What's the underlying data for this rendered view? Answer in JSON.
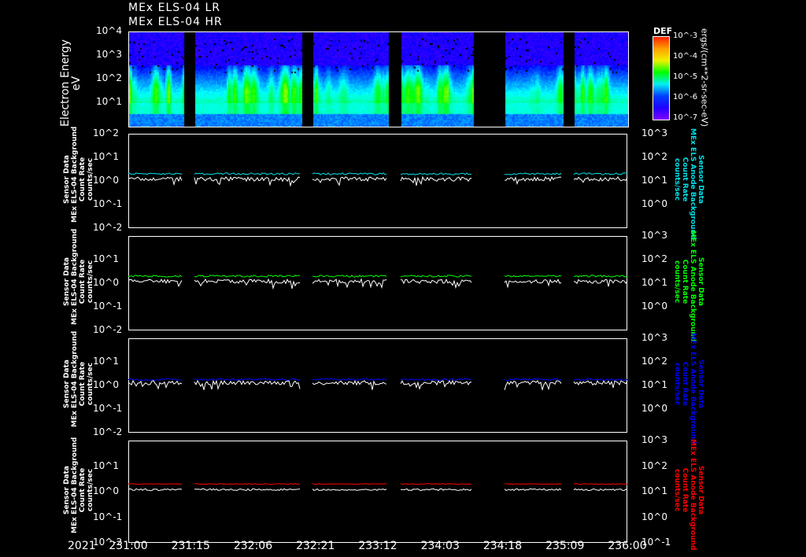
{
  "titles": [
    "MEx ELS-04 LR",
    "MEx ELS-04 HR"
  ],
  "colors": {
    "cyan": "#00e0e8",
    "green": "#00ff00",
    "blue": "#0000ff",
    "red": "#ff0000",
    "white": "#ffffff"
  },
  "chart_data": {
    "type": "heatmap+line",
    "year_label": "2021",
    "x_tick_labels": [
      "231:00",
      "231:15",
      "232:06",
      "232:21",
      "233:12",
      "234:03",
      "234:18",
      "235:09",
      "236:00"
    ],
    "data_gaps_fraction_of_time": [
      [
        0.11,
        0.132
      ],
      [
        0.345,
        0.368
      ],
      [
        0.52,
        0.543
      ],
      [
        0.688,
        0.752
      ],
      [
        0.87,
        0.892
      ]
    ],
    "spectrogram": {
      "ylabel": "Electron Energy",
      "yunits": "eV",
      "y_ticks": [
        "10^4",
        "10^3",
        "10^2",
        "10^1"
      ],
      "ylim": [
        1,
        10000
      ],
      "colorbar": {
        "title": "DEF",
        "units": "ergs/(cm**2-sr-sec-eV)",
        "ticks": [
          "10^-3",
          "10^-4",
          "10^-5",
          "10^-6",
          "10^-7"
        ],
        "range": [
          1e-07,
          0.001
        ]
      }
    },
    "panels": [
      {
        "left_label": [
          "Sensor Data",
          "MEx ELS-04 Background",
          "Count Rate",
          "counts/sec"
        ],
        "right_label": [
          "Sensor Data",
          "MEx ELS Anode Background",
          "Count Rate",
          "counts/sec"
        ],
        "color_key": "cyan",
        "colored_level": 2.0,
        "white_level": 1.2
      },
      {
        "left_label": [
          "Sensor Data",
          "MEx ELS-04 Background",
          "Count Rate",
          "counts/sec"
        ],
        "right_label": [
          "Sensor Data",
          "MEx ELS Anode Background",
          "Count Rate",
          "counts/sec"
        ],
        "color_key": "green",
        "colored_level": 2.0,
        "white_level": 1.2
      },
      {
        "left_label": [
          "Sensor Data",
          "MEx ELS-04 Background",
          "Count Rate",
          "counts/sec"
        ],
        "right_label": [
          "Sensor Data",
          "MEx ELS Anode Background",
          "Count Rate",
          "counts/sec"
        ],
        "color_key": "blue",
        "colored_level": 1.8,
        "white_level": 1.3
      },
      {
        "left_label": [
          "Sensor Data",
          "MEx ELS-04 Background",
          "Count Rate",
          "counts/sec"
        ],
        "right_label": [
          "Sensor Data",
          "MEx ELS Anode Background",
          "Count Rate",
          "counts/sec"
        ],
        "color_key": "red",
        "colored_level": 2.0,
        "white_level": 1.2
      }
    ],
    "left_y_ticks": [
      "10^2",
      "10^1",
      "10^0",
      "10^-1",
      "10^-2"
    ],
    "left_ylim": [
      0.01,
      100
    ],
    "right_y_ticks": [
      "10^3",
      "10^2",
      "10^1",
      "10^0",
      "10^-1"
    ],
    "right_ylim": [
      0.1,
      1000
    ]
  }
}
